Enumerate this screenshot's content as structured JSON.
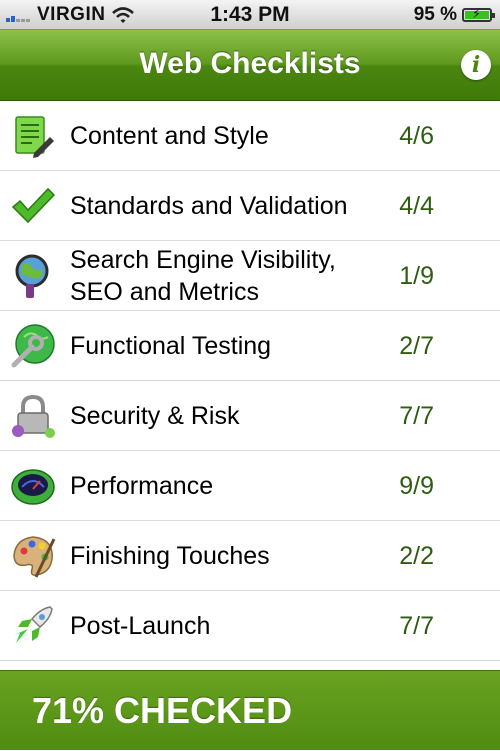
{
  "status_bar": {
    "carrier": "VIRGIN",
    "time": "1:43 PM",
    "battery_percent": "95 %",
    "battery_level": 0.95,
    "signal_icon": "signal-bars-icon",
    "wifi_icon": "wifi-icon"
  },
  "nav": {
    "title": "Web Checklists",
    "info_label": "i",
    "accent_color": "#4a8610"
  },
  "items": [
    {
      "label": "Content and Style",
      "count": "4/6",
      "icon": "document-edit-icon"
    },
    {
      "label": "Standards and Validation",
      "count": "4/4",
      "icon": "checkmark-icon"
    },
    {
      "label": "Search Engine Visibility, SEO and Metrics",
      "count": "1/9",
      "icon": "magnifier-globe-icon"
    },
    {
      "label": "Functional Testing",
      "count": "2/7",
      "icon": "wrench-globe-icon"
    },
    {
      "label": "Security & Risk",
      "count": "7/7",
      "icon": "padlock-icon"
    },
    {
      "label": "Performance",
      "count": "9/9",
      "icon": "speedometer-icon"
    },
    {
      "label": "Finishing Touches",
      "count": "2/2",
      "icon": "paint-palette-icon"
    },
    {
      "label": "Post-Launch",
      "count": "7/7",
      "icon": "rocket-icon"
    }
  ],
  "footer": {
    "summary": "71% CHECKED"
  }
}
